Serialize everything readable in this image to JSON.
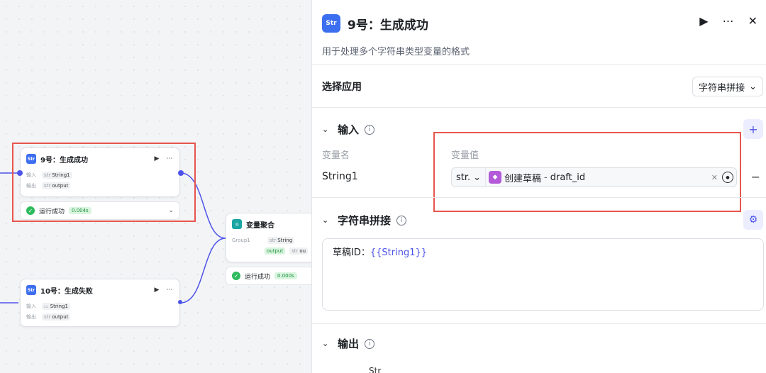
{
  "canvas": {
    "node9": {
      "icon": "Str",
      "title": "9号：生成成功",
      "input_label": "输入",
      "input_type": "str",
      "input_value": "String1",
      "output_label": "输出",
      "output_type": "str",
      "output_value": "output",
      "status": "运行成功",
      "time": "0.004s"
    },
    "agg": {
      "title": "变量聚合",
      "group_label": "Group1",
      "type1": "str",
      "value1": "String",
      "value2": "output",
      "type3": "str",
      "value3": "ou",
      "status": "运行成功",
      "time": "0.000s"
    },
    "node10": {
      "icon": "Str",
      "title": "10号：生成失败",
      "input_label": "输入",
      "input_value": "String1",
      "output_label": "输出",
      "output_type": "str",
      "output_value": "output"
    }
  },
  "panel": {
    "icon": "Str",
    "title": "9号：生成成功",
    "description": "用于处理多个字符串类型变量的格式",
    "select_app_label": "选择应用",
    "select_app_value": "字符串拼接",
    "input_section": "输入",
    "col_name": "变量名",
    "col_value": "变量值",
    "row_name": "String1",
    "row_type": "str.",
    "ref_node": "创建草稿",
    "ref_sep": "-",
    "ref_field": "draft_id",
    "concat_section": "字符串拼接",
    "template_text": "草稿ID：",
    "template_var": "{{String1}}",
    "output_section": "输出",
    "output_tag": "Str"
  },
  "colors": {
    "accent": "#4d53e8",
    "highlight": "#e8554e",
    "success": "#2dbb5d"
  },
  "icons": [
    "play-icon",
    "more-icon",
    "close-icon",
    "info-icon",
    "plus-icon",
    "minus-icon",
    "gear-icon",
    "target-icon",
    "chevron-down-icon"
  ]
}
